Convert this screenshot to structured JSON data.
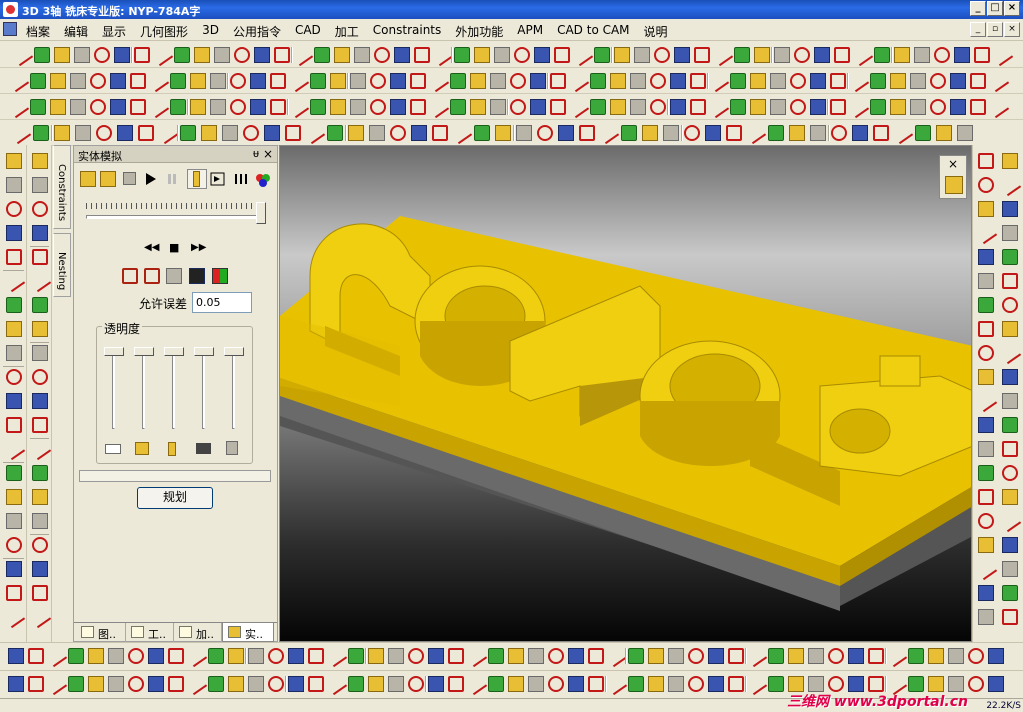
{
  "window": {
    "title": "3D 3轴 铣床专业版: NYP-784A字",
    "controls": [
      "_",
      "□",
      "×"
    ]
  },
  "menu": [
    "档案",
    "编辑",
    "显示",
    "几何图形",
    "3D",
    "公用指令",
    "CAD",
    "加工",
    "Constraints",
    "外加功能",
    "APM",
    "CAD to CAM",
    "说明"
  ],
  "mdi_controls": [
    "_",
    "▫",
    "×"
  ],
  "side_tabs": [
    "Constraints",
    "Nesting"
  ],
  "panel": {
    "title": "实体模拟",
    "pin": "ᵾ",
    "close": "×",
    "playback": {
      "rewind": "◀◀",
      "stop": "■",
      "forward": "▶▶"
    },
    "tolerance_label": "允许误差",
    "tolerance_value": "0.05",
    "transparency_label": "透明度",
    "plan_button": "规划",
    "tabs": [
      "图..",
      "工..",
      "加..",
      "实.."
    ]
  },
  "colors": {
    "accent_red": "#c21818",
    "model_yellow": "#e8c200",
    "titlebar_blue": "#2a6be6"
  },
  "status": {
    "watermark": "三维网 www.3dportal.cn",
    "speed": "22.2K/S"
  }
}
